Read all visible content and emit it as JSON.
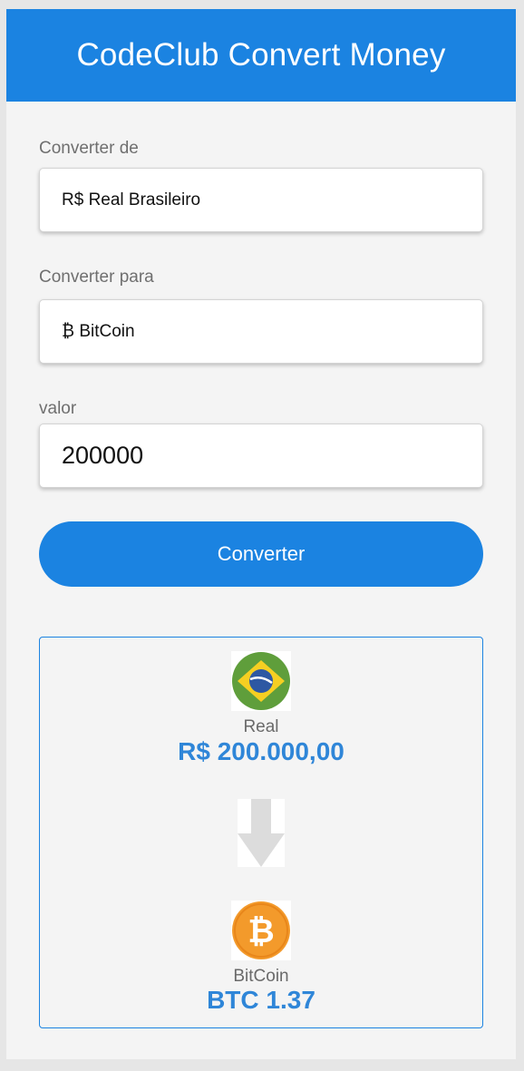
{
  "header": {
    "title": "CodeClub Convert Money"
  },
  "form": {
    "from_label": "Converter de",
    "from_value": "R$ Real Brasileiro",
    "to_label": "Converter para",
    "to_value": "₿ BitCoin",
    "amount_label": "valor",
    "amount_value": "200000",
    "convert_label": "Converter"
  },
  "result": {
    "from": {
      "name": "Real",
      "value": "R$ 200.000,00",
      "icon": "brazil-flag-icon"
    },
    "to": {
      "name": "BitCoin",
      "value": "BTC 1.37",
      "icon": "bitcoin-icon"
    },
    "arrow_icon": "arrow-down-icon"
  },
  "colors": {
    "primary": "#1b83e1",
    "value_text": "#2f86d8",
    "panel_bg": "#f4f4f4",
    "flag_green": "#5f9e3b",
    "flag_yellow": "#f5cf22",
    "flag_blue": "#2d58a3",
    "bitcoin_orange": "#f39a2b"
  }
}
